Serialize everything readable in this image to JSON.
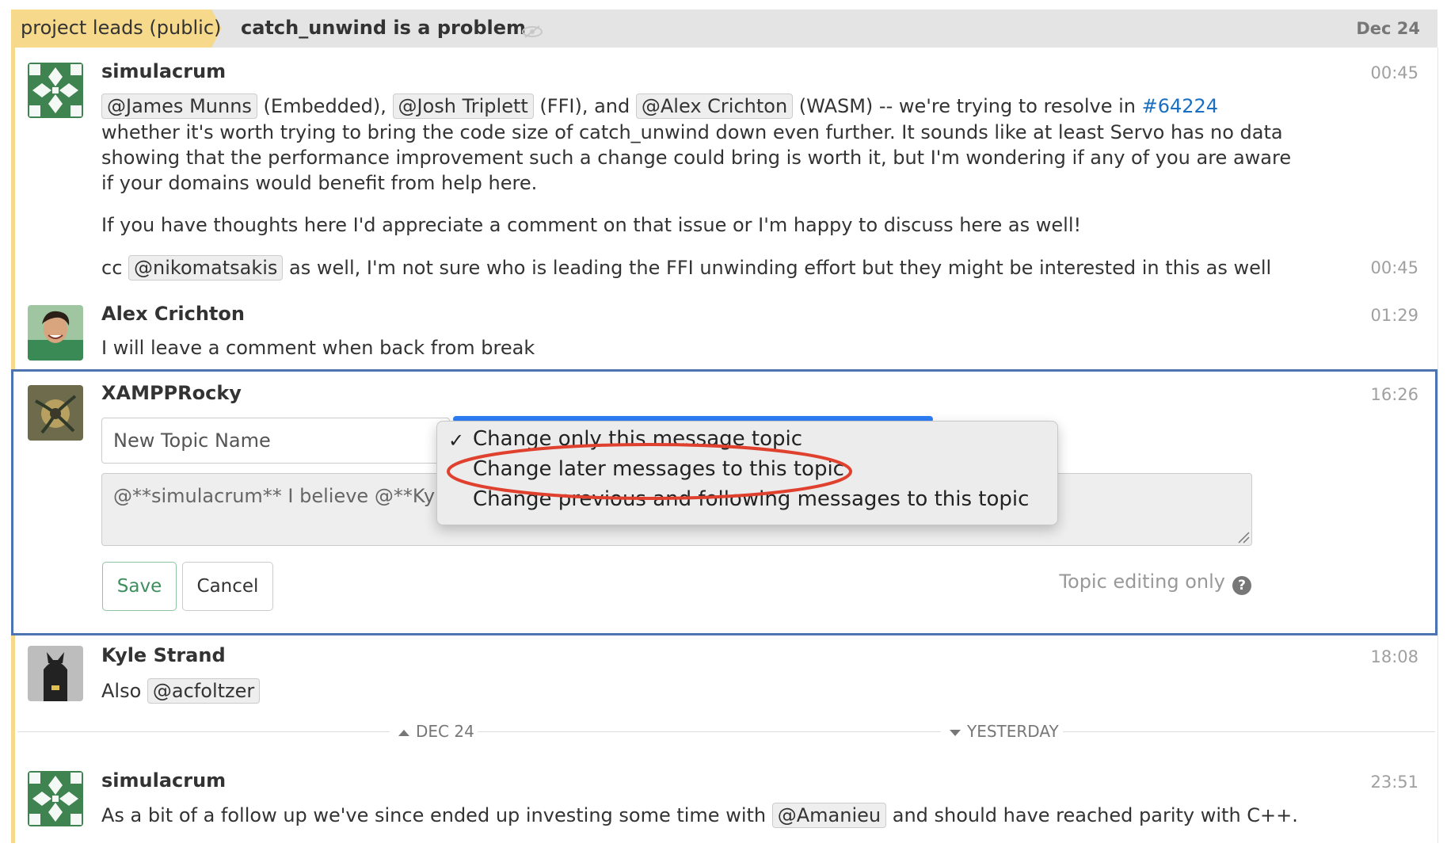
{
  "header": {
    "stream": "project leads (public)",
    "topic": "catch_unwind is a problem",
    "date": "Dec 24"
  },
  "messages": [
    {
      "sender": "simulacrum",
      "time": "00:45",
      "p1": {
        "m1": "@James Munns",
        "t1": " (Embedded), ",
        "m2": "@Josh Triplett",
        "t2": " (FFI), and ",
        "m3": "@Alex Crichton",
        "t3": " (WASM) -- we're trying to resolve in ",
        "link": "#64224"
      },
      "p1_line2": "whether it's worth trying to bring the code size of catch_unwind down even further. It sounds like at least Servo has no data",
      "p1_line3": "showing that the performance improvement such a change could bring is worth it, but I'm wondering if any of you are aware",
      "p1_line4": "if your domains would benefit from help here.",
      "p2": "If you have thoughts here I'd appreciate a comment on that issue or I'm happy to discuss here as well!",
      "p3": {
        "prefix": "cc ",
        "mention": "@nikomatsakis",
        "rest": " as well, I'm not sure who is leading the FFI unwinding effort but they might be interested in this as well"
      },
      "p3_time": "00:45"
    },
    {
      "sender": "Alex Crichton",
      "time": "01:29",
      "text": "I will leave a comment when back from break"
    },
    {
      "sender": "XAMPPRocky",
      "time": "16:26"
    },
    {
      "sender": "Kyle Strand",
      "time": "18:08",
      "prefix": "Also ",
      "mention": "@acfoltzer"
    },
    {
      "sender": "simulacrum",
      "time": "23:51",
      "prefix": "As a bit of a follow up we've since ended up investing some time with ",
      "mention": "@Amanieu",
      "rest": " and should have reached parity with C++."
    }
  ],
  "edit": {
    "topic_placeholder": "New Topic Name",
    "content": "@**simulacrum** I believe @**Kyle",
    "save": "Save",
    "cancel": "Cancel",
    "topic_only": "Topic editing only",
    "help": "?",
    "dropdown": {
      "selected": "Change only this message topic",
      "options": [
        "Change only this message topic",
        "Change later messages to this topic",
        "Change previous and following messages to this topic"
      ],
      "check": "✓"
    },
    "highlight_color": "#e0412f"
  },
  "divider": {
    "left": "DEC 24",
    "right": "YESTERDAY"
  },
  "colors": {
    "stream": "#f6d98b",
    "edit_border": "#4d73b0",
    "link": "#1a6fc1",
    "save_green": "#3f8f5e"
  }
}
